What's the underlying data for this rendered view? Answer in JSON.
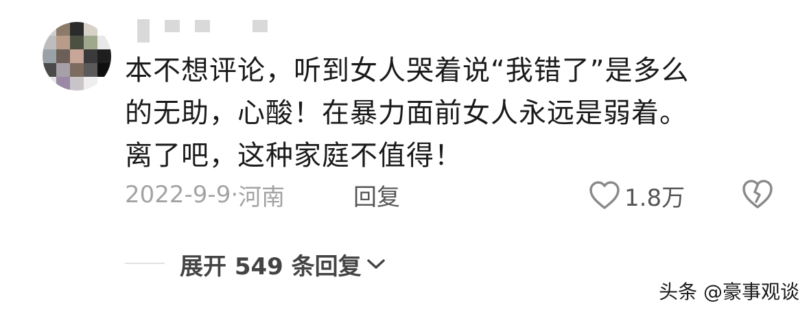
{
  "comment": {
    "lines": [
      "本不想评论，听到女人哭着说“我错了”是多么",
      "的无助，心酸！在暴力面前女人永远是弱着。",
      "离了吧，这种家庭不值得！"
    ],
    "date": "2022-9-9",
    "separator": "·",
    "location": "河南",
    "reply_label": "回复",
    "like_count": "1.8万"
  },
  "icons": {
    "like": "heart-outline-icon",
    "dislike": "broken-heart-icon",
    "expand": "chevron-down-icon"
  },
  "expand_replies": {
    "label": "展开 549 条回复"
  },
  "watermark": {
    "text": "头条 @豪事观谈"
  },
  "colors": {
    "text": "#1a1a1a",
    "meta": "#a3a3a3",
    "action": "#555555",
    "icon": "#8a8a8a"
  }
}
